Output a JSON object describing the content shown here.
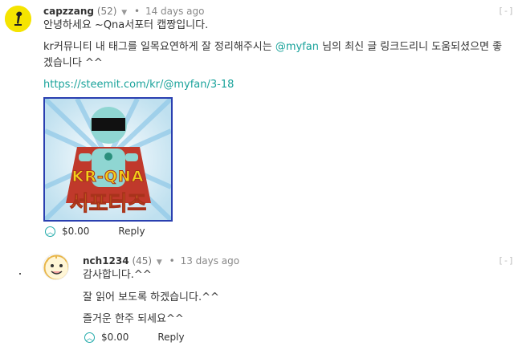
{
  "comment1": {
    "author": "capzzang",
    "reputation": "(52)",
    "time": "14 days ago",
    "collapse": "[-]",
    "greeting": "안녕하세요 ~Qna서포터 캡짱입니다.",
    "body_pre": "kr커뮤니티 내 태그를 일목요연하게 잘 정리해주시는 ",
    "mention": "@myfan",
    "body_post_line1": " 님의 최신 글 링크드리니 도움되셨으면 좋",
    "body_line2": "겠습니다 ^^",
    "link": "https://steemit.com/kr/@myfan/3-18",
    "image_text_top": "KR-QNA",
    "image_text_bottom": "서포터즈",
    "payout": "$0.00",
    "reply_label": "Reply"
  },
  "comment2": {
    "author": "nch1234",
    "reputation": "(45)",
    "time": "13 days ago",
    "collapse": "[-]",
    "line1": "감사합니다.^^",
    "line2": "잘 읽어 보도록 하겠습니다.^^",
    "line3": "즐거운 한주 되세요^^",
    "payout": "$0.00",
    "reply_label": "Reply"
  }
}
